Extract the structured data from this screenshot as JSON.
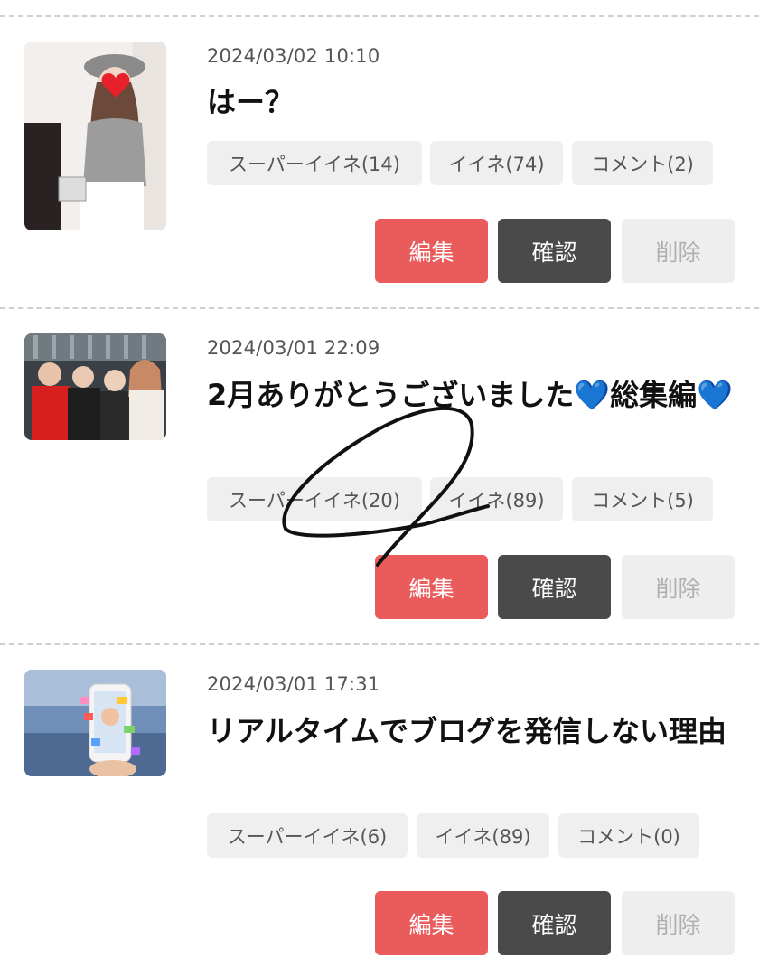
{
  "posts": [
    {
      "date": "2024/03/02 10:10",
      "title": "はー？",
      "chips": {
        "super_like": "スーパーイイネ(14)",
        "like": "イイネ(74)",
        "comment": "コメント(2)"
      },
      "buttons": {
        "edit": "編集",
        "confirm": "確認",
        "delete": "削除"
      }
    },
    {
      "date": "2024/03/01 22:09",
      "title": "2月ありがとうございました💙総集編💙",
      "chips": {
        "super_like": "スーパーイイネ(20)",
        "like": "イイネ(89)",
        "comment": "コメント(5)"
      },
      "buttons": {
        "edit": "編集",
        "confirm": "確認",
        "delete": "削除"
      }
    },
    {
      "date": "2024/03/01 17:31",
      "title": "リアルタイムでブログを発信しない理由",
      "chips": {
        "super_like": "スーパーイイネ(6)",
        "like": "イイネ(89)",
        "comment": "コメント(0)"
      },
      "buttons": {
        "edit": "編集",
        "confirm": "確認",
        "delete": "削除"
      }
    }
  ],
  "colors": {
    "edit": "#ea5b5b",
    "confirm": "#4a4a4a",
    "delete_bg": "#eeeeee",
    "chip_bg": "#efefef"
  }
}
